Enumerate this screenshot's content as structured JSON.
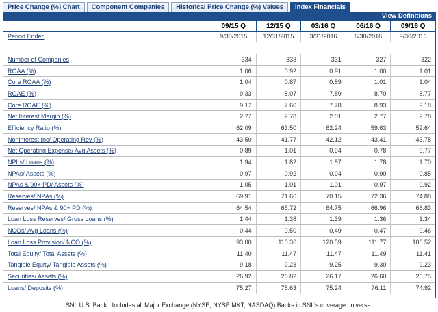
{
  "tabs": [
    {
      "label": "Price Change (%) Chart",
      "active": false
    },
    {
      "label": "Component Companies",
      "active": false
    },
    {
      "label": "Historical Price Change (%) Values",
      "active": false
    },
    {
      "label": "Index Financials",
      "active": true
    }
  ],
  "view_definitions": "View Definitions",
  "columns": [
    "09/15 Q",
    "12/15 Q",
    "03/16 Q",
    "06/16 Q",
    "09/16 Q"
  ],
  "period_ended": {
    "label": "Period Ended",
    "values": [
      "9/30/2015",
      "12/31/2015",
      "3/31/2016",
      "6/30/2016",
      "9/30/2016"
    ]
  },
  "rows": [
    {
      "label": "Number of Companies",
      "values": [
        "334",
        "333",
        "331",
        "327",
        "322"
      ]
    },
    {
      "label": "ROAA (%)",
      "values": [
        "1.06",
        "0.92",
        "0.91",
        "1.00",
        "1.01"
      ]
    },
    {
      "label": "Core ROAA (%)",
      "values": [
        "1.04",
        "0.87",
        "0.89",
        "1.01",
        "1.04"
      ]
    },
    {
      "label": "ROAE (%)",
      "values": [
        "9.33",
        "8.07",
        "7.89",
        "8.70",
        "8.77"
      ]
    },
    {
      "label": "Core ROAE (%)",
      "values": [
        "9.17",
        "7.60",
        "7.78",
        "8.93",
        "9.18"
      ]
    },
    {
      "label": "Net Interest Margin (%)",
      "values": [
        "2.77",
        "2.78",
        "2.81",
        "2.77",
        "2.78"
      ]
    },
    {
      "label": "Efficiency Ratio (%)",
      "values": [
        "62.09",
        "63.50",
        "62.24",
        "59.63",
        "59.64"
      ]
    },
    {
      "label": "Noninterest Inc/ Operating Rev (%)",
      "values": [
        "43.50",
        "41.77",
        "42.12",
        "43.41",
        "43.78"
      ]
    },
    {
      "label": "Net Operating Expense/ Avg Assets (%)",
      "values": [
        "0.89",
        "1.01",
        "0.94",
        "0.78",
        "0.77"
      ]
    },
    {
      "label": "NPLs/ Loans (%)",
      "values": [
        "1.94",
        "1.82",
        "1.87",
        "1.78",
        "1.70"
      ]
    },
    {
      "label": "NPAs/ Assets (%)",
      "values": [
        "0.97",
        "0.92",
        "0.94",
        "0.90",
        "0.85"
      ]
    },
    {
      "label": "NPAs & 90+ PD/ Assets (%)",
      "values": [
        "1.05",
        "1.01",
        "1.01",
        "0.97",
        "0.92"
      ]
    },
    {
      "label": "Reserves/ NPAs (%)",
      "values": [
        "69.91",
        "71.66",
        "70.15",
        "72.36",
        "74.88"
      ]
    },
    {
      "label": "Reserves/ NPAs & 90+ PD (%)",
      "values": [
        "64.54",
        "65.72",
        "64.75",
        "66.96",
        "68.83"
      ]
    },
    {
      "label": "Loan Loss Reserves/ Gross Loans (%)",
      "values": [
        "1.44",
        "1.38",
        "1.39",
        "1.36",
        "1.34"
      ]
    },
    {
      "label": "NCOs/ Avg Loans (%)",
      "values": [
        "0.44",
        "0.50",
        "0.49",
        "0.47",
        "0.46"
      ]
    },
    {
      "label": "Loan Loss Provision/ NCO (%)",
      "values": [
        "93.00",
        "110.36",
        "120.59",
        "111.77",
        "106.52"
      ]
    },
    {
      "label": "Total Equity/ Total Assets (%)",
      "values": [
        "11.40",
        "11.47",
        "11.47",
        "11.49",
        "11.41"
      ]
    },
    {
      "label": "Tangible Equity/ Tangible Assets (%)",
      "values": [
        "9.18",
        "9.23",
        "9.25",
        "9.30",
        "9.23"
      ]
    },
    {
      "label": "Securities/ Assets (%)",
      "values": [
        "26.92",
        "26.82",
        "26.17",
        "26.60",
        "26.75"
      ]
    },
    {
      "label": "Loans/ Deposits (%)",
      "values": [
        "75.27",
        "75.63",
        "75.24",
        "76.11",
        "74.92"
      ]
    }
  ],
  "footnote": "SNL U.S. Bank : Includes all Major Exchange (NYSE, NYSE MKT, NASDAQ) Banks in SNL's coverage universe.",
  "colors": {
    "accent": "#1f4e8c",
    "link": "#1d3f78"
  }
}
